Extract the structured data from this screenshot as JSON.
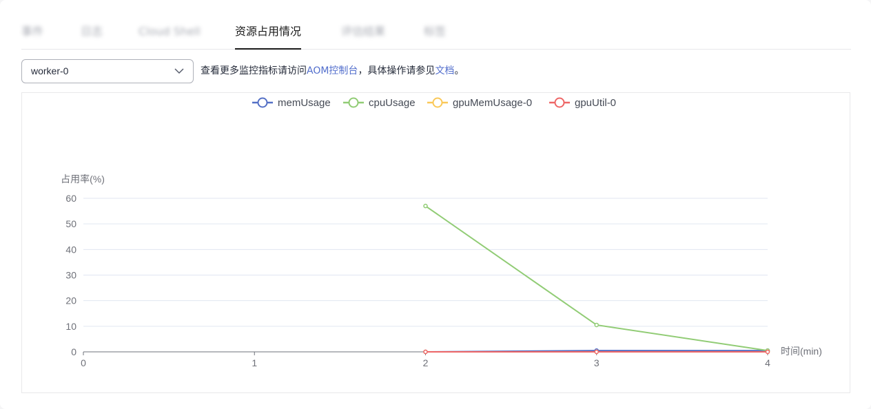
{
  "tabs": [
    {
      "label": "事件",
      "blurred": true
    },
    {
      "label": "日志",
      "blurred": true
    },
    {
      "label": "Cloud Shell",
      "blurred": true
    },
    {
      "label": "资源占用情况",
      "active": true
    },
    {
      "label": "评估结果",
      "blurred": true
    },
    {
      "label": "标签",
      "blurred": true
    }
  ],
  "worker_select": {
    "value": "worker-0"
  },
  "hint": {
    "prefix": "查看更多监控指标请访问",
    "link1": "AOM控制台",
    "middle": "，具体操作请参见",
    "link2": "文档",
    "suffix": "。"
  },
  "colors": {
    "accent": "#526ecc",
    "text": "#252b3a",
    "border": "#e8e8ea"
  },
  "chart_data": {
    "type": "line",
    "ylabel": "占用率(%)",
    "xlabel": "时间(min)",
    "ylim": [
      0,
      60
    ],
    "yticks": [
      0,
      10,
      20,
      30,
      40,
      50,
      60
    ],
    "xlim": [
      0,
      4
    ],
    "xticks": [
      0,
      1,
      2,
      3,
      4
    ],
    "grid": true,
    "legend_position": "top-center",
    "series": [
      {
        "name": "memUsage",
        "color": "#5470c6",
        "x": [
          2,
          3,
          4
        ],
        "y": [
          0,
          0.5,
          0.5
        ]
      },
      {
        "name": "cpuUsage",
        "color": "#91cc75",
        "x": [
          2,
          3,
          4
        ],
        "y": [
          57,
          10.5,
          0.5
        ]
      },
      {
        "name": "gpuMemUsage-0",
        "color": "#fac858",
        "x": [
          2,
          3,
          4
        ],
        "y": [
          0,
          0,
          0
        ]
      },
      {
        "name": "gpuUtil-0",
        "color": "#ee6666",
        "x": [
          2,
          3,
          4
        ],
        "y": [
          0,
          0,
          0
        ]
      }
    ]
  }
}
